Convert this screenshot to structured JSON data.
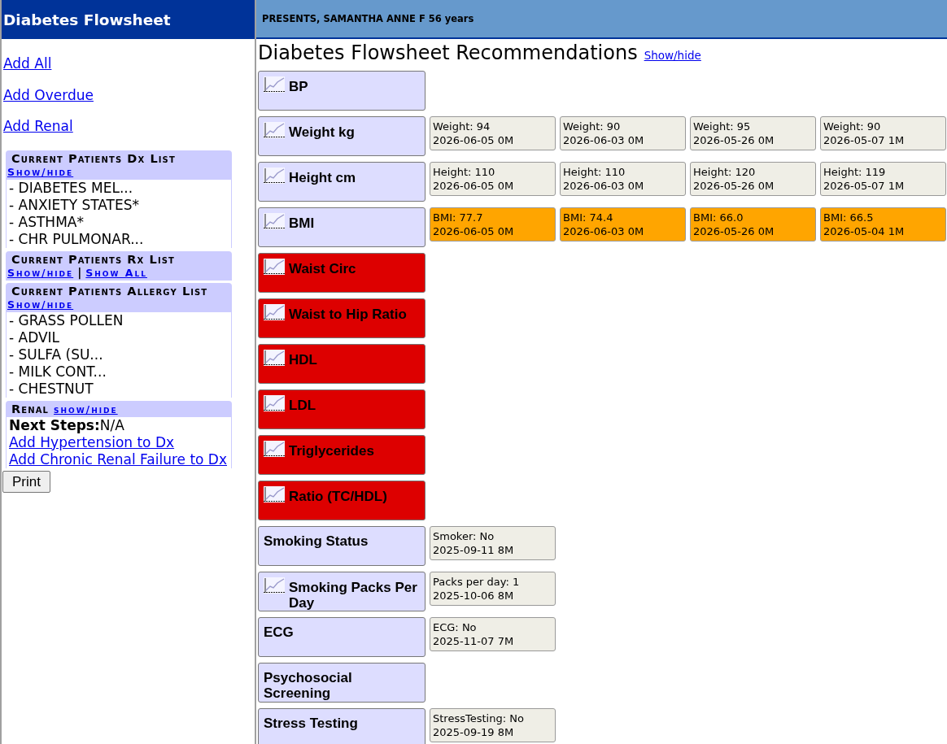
{
  "sidebar": {
    "title": "Diabetes Flowsheet",
    "actions": [
      "Add All",
      "Add Overdue",
      "Add Renal"
    ],
    "panels": [
      {
        "kind": "list",
        "title": "Current Patients Dx List",
        "links": [
          "Show/hide"
        ],
        "items": [
          "- DIABETES MEL...",
          "- ANXIETY STATES*",
          "- ASTHMA*",
          "- CHR PULMONAR..."
        ]
      },
      {
        "kind": "list",
        "title": "Current Patients Rx List",
        "links": [
          "Show/hide",
          "Show All"
        ],
        "separator": "|"
      },
      {
        "kind": "list",
        "title": "Current Patients Allergy List",
        "links": [
          "Show/hide"
        ],
        "items": [
          "- GRASS POLLEN",
          "- ADVIL",
          "- SULFA (SU...",
          "- MILK CONT...",
          "- CHESTNUT"
        ]
      },
      {
        "kind": "renal",
        "title": "Renal",
        "links": [
          "show/hide"
        ],
        "next_steps": "**Next Steps:**N/A",
        "actions": [
          "Add Hypertension to Dx",
          "Add Chronic Renal Failure to Dx"
        ]
      }
    ],
    "print_button": "Print"
  },
  "main": {
    "patient_banner": "PRESENTS, SAMANTHA ANNE F 56 years",
    "title": "Diabetes Flowsheet Recommendations",
    "title_link": "Show/hide",
    "measures": [
      {
        "label": "BP",
        "chart_icon": true,
        "color": "#ddddff"
      },
      {
        "label": "Weight kg",
        "chart_icon": true,
        "color": "#ddddff",
        "results": [
          {
            "value": "Weight: 94",
            "date": "2026-06-05 0M",
            "color": "#efeee6"
          },
          {
            "value": "Weight: 90",
            "date": "2026-06-03 0M",
            "color": "#efeee6"
          },
          {
            "value": "Weight: 95",
            "date": "2026-05-26 0M",
            "color": "#efeee6"
          },
          {
            "value": "Weight: 90",
            "date": "2026-05-07 1M",
            "color": "#efeee6"
          }
        ]
      },
      {
        "label": "Height cm",
        "chart_icon": true,
        "color": "#ddddff",
        "results": [
          {
            "value": "Height: 110",
            "date": "2026-06-05 0M",
            "color": "#efeee6"
          },
          {
            "value": "Height: 110",
            "date": "2026-06-03 0M",
            "color": "#efeee6"
          },
          {
            "value": "Height: 120",
            "date": "2026-05-26 0M",
            "color": "#efeee6"
          },
          {
            "value": "Height: 119",
            "date": "2026-05-07 1M",
            "color": "#efeee6"
          }
        ]
      },
      {
        "label": "BMI",
        "chart_icon": true,
        "color": "#ddddff",
        "results": [
          {
            "value": "BMI: 77.7",
            "date": "2026-06-05 0M",
            "color": "#ffa500"
          },
          {
            "value": "BMI: 74.4",
            "date": "2026-06-03 0M",
            "color": "#ffa500"
          },
          {
            "value": "BMI: 66.0",
            "date": "2026-05-26 0M",
            "color": "#ffa500"
          },
          {
            "value": "BMI: 66.5",
            "date": "2026-05-04 1M",
            "color": "#ffa500"
          }
        ]
      },
      {
        "label": "Waist Circ",
        "chart_icon": true,
        "color": "#dd0000"
      },
      {
        "label": "Waist to Hip Ratio",
        "chart_icon": true,
        "color": "#dd0000"
      },
      {
        "label": "HDL",
        "chart_icon": true,
        "color": "#dd0000"
      },
      {
        "label": "LDL",
        "chart_icon": true,
        "color": "#dd0000"
      },
      {
        "label": "Triglycerides",
        "chart_icon": true,
        "color": "#dd0000"
      },
      {
        "label": "Ratio (TC/HDL)",
        "chart_icon": true,
        "color": "#dd0000"
      },
      {
        "label": "Smoking Status",
        "chart_icon": false,
        "color": "#ddddff",
        "results": [
          {
            "value": "Smoker: No",
            "date": "2025-09-11 8M",
            "color": "#efeee6"
          }
        ]
      },
      {
        "label": "Smoking Packs Per Day",
        "chart_icon": true,
        "color": "#ddddff",
        "results": [
          {
            "value": "Packs per day: 1",
            "date": "2025-10-06 8M",
            "color": "#efeee6"
          }
        ]
      },
      {
        "label": "ECG",
        "chart_icon": false,
        "color": "#ddddff",
        "results": [
          {
            "value": "ECG: No",
            "date": "2025-11-07 7M",
            "color": "#efeee6"
          }
        ]
      },
      {
        "label": "Psychosocial Screening",
        "chart_icon": false,
        "color": "#ddddff"
      },
      {
        "label": "Stress Testing",
        "chart_icon": false,
        "color": "#ddddff",
        "results": [
          {
            "value": "StressTesting: No",
            "date": "2025-09-19 8M",
            "color": "#efeee6"
          }
        ]
      }
    ]
  }
}
